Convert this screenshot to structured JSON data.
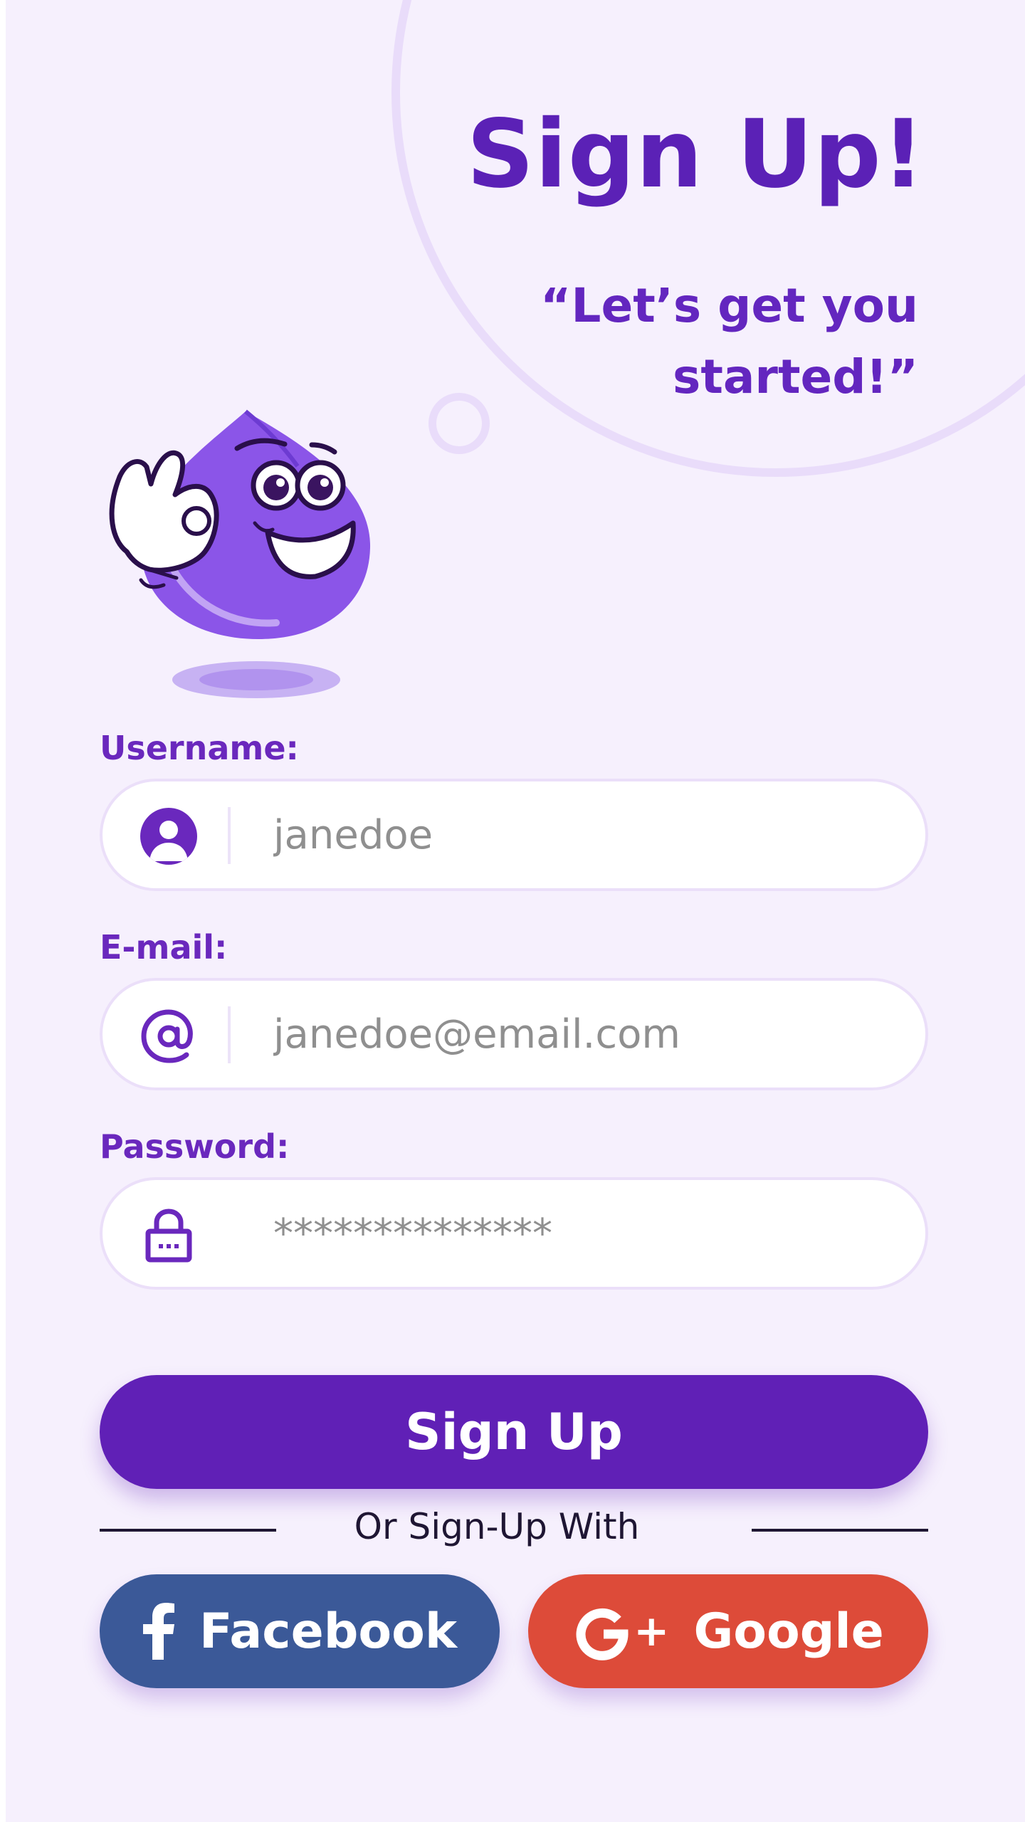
{
  "header": {
    "title": "Sign Up!",
    "tagline": "“Let’s get you started!”"
  },
  "form": {
    "username": {
      "label": "Username:",
      "placeholder": "janedoe",
      "icon": "user-icon"
    },
    "email": {
      "label": "E-mail:",
      "placeholder": "janedoe@email.com",
      "icon": "at-sign-icon"
    },
    "password": {
      "label": "Password:",
      "placeholder": "**************",
      "icon": "lock-icon"
    },
    "submit_label": "Sign Up"
  },
  "social": {
    "divider_text": "Or Sign-Up With",
    "facebook_label": "Facebook",
    "google_label": "Google",
    "google_icon_text": "+"
  },
  "colors": {
    "background": "#f6f0fd",
    "accent": "#6020b6",
    "facebook": "#3b5998",
    "google": "#dd4b39"
  }
}
